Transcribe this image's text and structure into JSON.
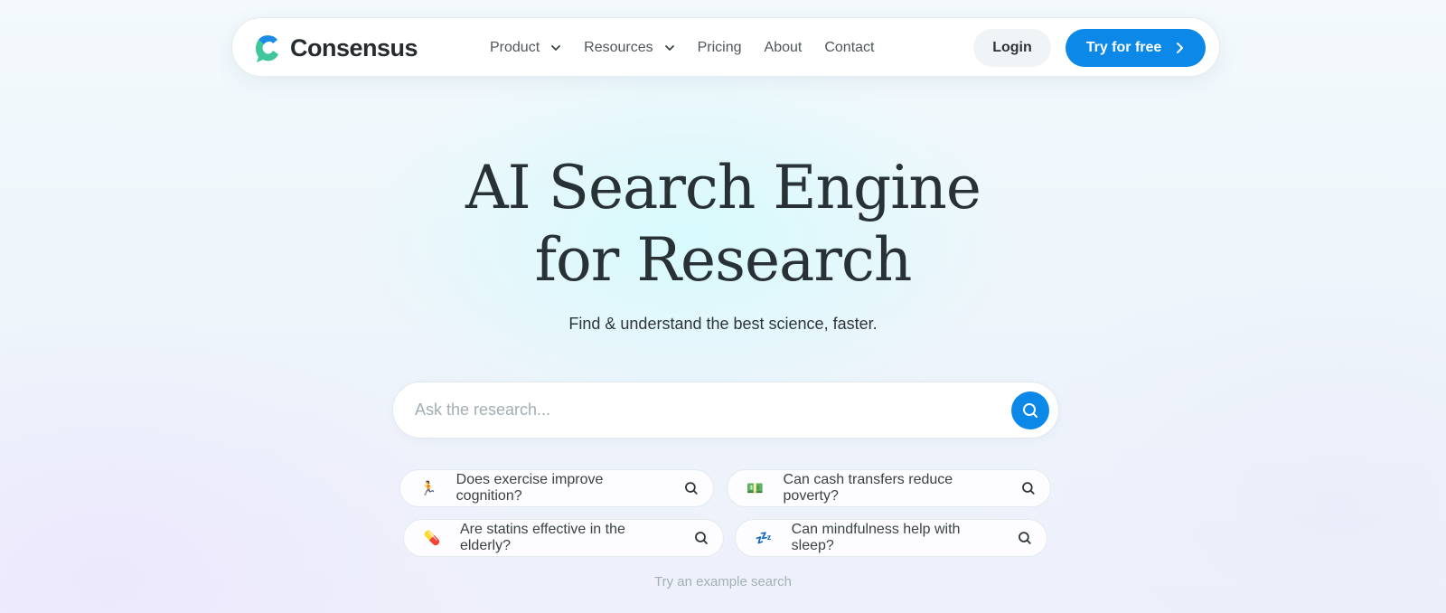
{
  "nav": {
    "logo_text": "Consensus",
    "menu": [
      {
        "label": "Product",
        "has_dropdown": true
      },
      {
        "label": "Resources",
        "has_dropdown": true
      },
      {
        "label": "Pricing",
        "has_dropdown": false
      },
      {
        "label": "About",
        "has_dropdown": false
      },
      {
        "label": "Contact",
        "has_dropdown": false
      }
    ],
    "login_label": "Login",
    "try_label": "Try for free"
  },
  "hero": {
    "title_line1": "AI Search Engine",
    "title_line2": "for Research",
    "subtitle": "Find & understand the best science, faster."
  },
  "search": {
    "placeholder": "Ask the research...",
    "value": ""
  },
  "examples": [
    {
      "icon": "running-person-icon",
      "emoji": "🏃",
      "text": "Does exercise improve cognition?"
    },
    {
      "icon": "money-icon",
      "emoji": "💵",
      "text": "Can cash transfers reduce poverty?"
    },
    {
      "icon": "pill-icon",
      "emoji": "💊",
      "text": "Are statins effective in the elderly?"
    },
    {
      "icon": "sleep-icon",
      "emoji": "💤",
      "text": "Can mindfulness help with sleep?"
    }
  ],
  "hint": "Try an example search",
  "colors": {
    "accent": "#0b88e8",
    "logo_blue": "#1a8be6",
    "logo_green": "#3fc69a",
    "text_dark": "#283236"
  }
}
